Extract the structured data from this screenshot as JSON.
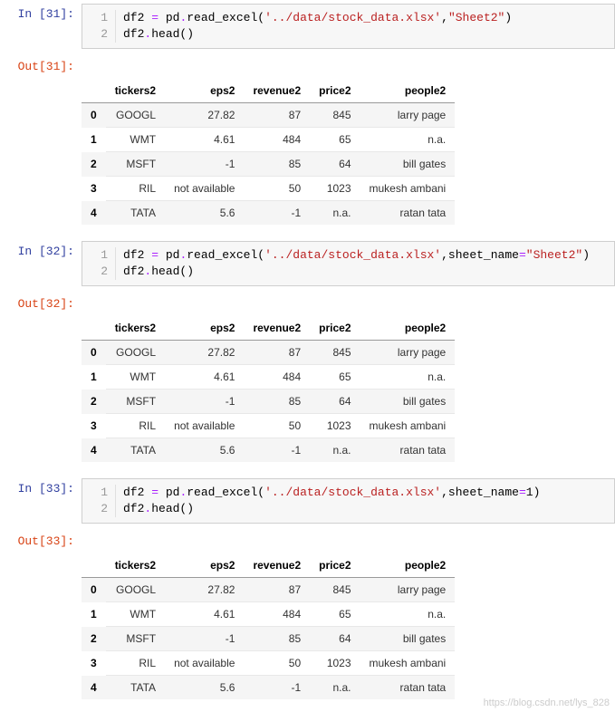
{
  "cells": [
    {
      "in_prompt": "In  [31]:",
      "out_prompt": "Out[31]:",
      "lines": [
        "1",
        "2"
      ],
      "code_html": "df2 <span class='tok-op'>=</span> pd<span class='tok-op'>.</span>read_excel(<span class='tok-str'>'../data/stock_data.xlsx'</span>,<span class='tok-str'>\"Sheet2\"</span>)\ndf2<span class='tok-op'>.</span>head()"
    },
    {
      "in_prompt": "In  [32]:",
      "out_prompt": "Out[32]:",
      "lines": [
        "1",
        "2"
      ],
      "code_html": "df2 <span class='tok-op'>=</span> pd<span class='tok-op'>.</span>read_excel(<span class='tok-str'>'../data/stock_data.xlsx'</span>,sheet_name<span class='tok-op'>=</span><span class='tok-str'>\"Sheet2\"</span>)\ndf2<span class='tok-op'>.</span>head()"
    },
    {
      "in_prompt": "In  [33]:",
      "out_prompt": "Out[33]:",
      "lines": [
        "1",
        "2"
      ],
      "code_html": "df2 <span class='tok-op'>=</span> pd<span class='tok-op'>.</span>read_excel(<span class='tok-str'>'../data/stock_data.xlsx'</span>,sheet_name<span class='tok-op'>=</span>1)\ndf2<span class='tok-op'>.</span>head()"
    }
  ],
  "table": {
    "columns": [
      "tickers2",
      "eps2",
      "revenue2",
      "price2",
      "people2"
    ],
    "index": [
      "0",
      "1",
      "2",
      "3",
      "4"
    ],
    "rows": [
      [
        "GOOGL",
        "27.82",
        "87",
        "845",
        "larry page"
      ],
      [
        "WMT",
        "4.61",
        "484",
        "65",
        "n.a."
      ],
      [
        "MSFT",
        "-1",
        "85",
        "64",
        "bill gates"
      ],
      [
        "RIL",
        "not available",
        "50",
        "1023",
        "mukesh ambani"
      ],
      [
        "TATA",
        "5.6",
        "-1",
        "n.a.",
        "ratan tata"
      ]
    ]
  },
  "watermark": "https://blog.csdn.net/lys_828",
  "chart_data": {
    "type": "table",
    "title": "df2.head() output (repeated 3 times with same data)",
    "columns": [
      "tickers2",
      "eps2",
      "revenue2",
      "price2",
      "people2"
    ],
    "rows": [
      {
        "tickers2": "GOOGL",
        "eps2": 27.82,
        "revenue2": 87,
        "price2": 845,
        "people2": "larry page"
      },
      {
        "tickers2": "WMT",
        "eps2": 4.61,
        "revenue2": 484,
        "price2": 65,
        "people2": "n.a."
      },
      {
        "tickers2": "MSFT",
        "eps2": -1,
        "revenue2": 85,
        "price2": 64,
        "people2": "bill gates"
      },
      {
        "tickers2": "RIL",
        "eps2": "not available",
        "revenue2": 50,
        "price2": 1023,
        "people2": "mukesh ambani"
      },
      {
        "tickers2": "TATA",
        "eps2": 5.6,
        "revenue2": -1,
        "price2": "n.a.",
        "people2": "ratan tata"
      }
    ]
  }
}
